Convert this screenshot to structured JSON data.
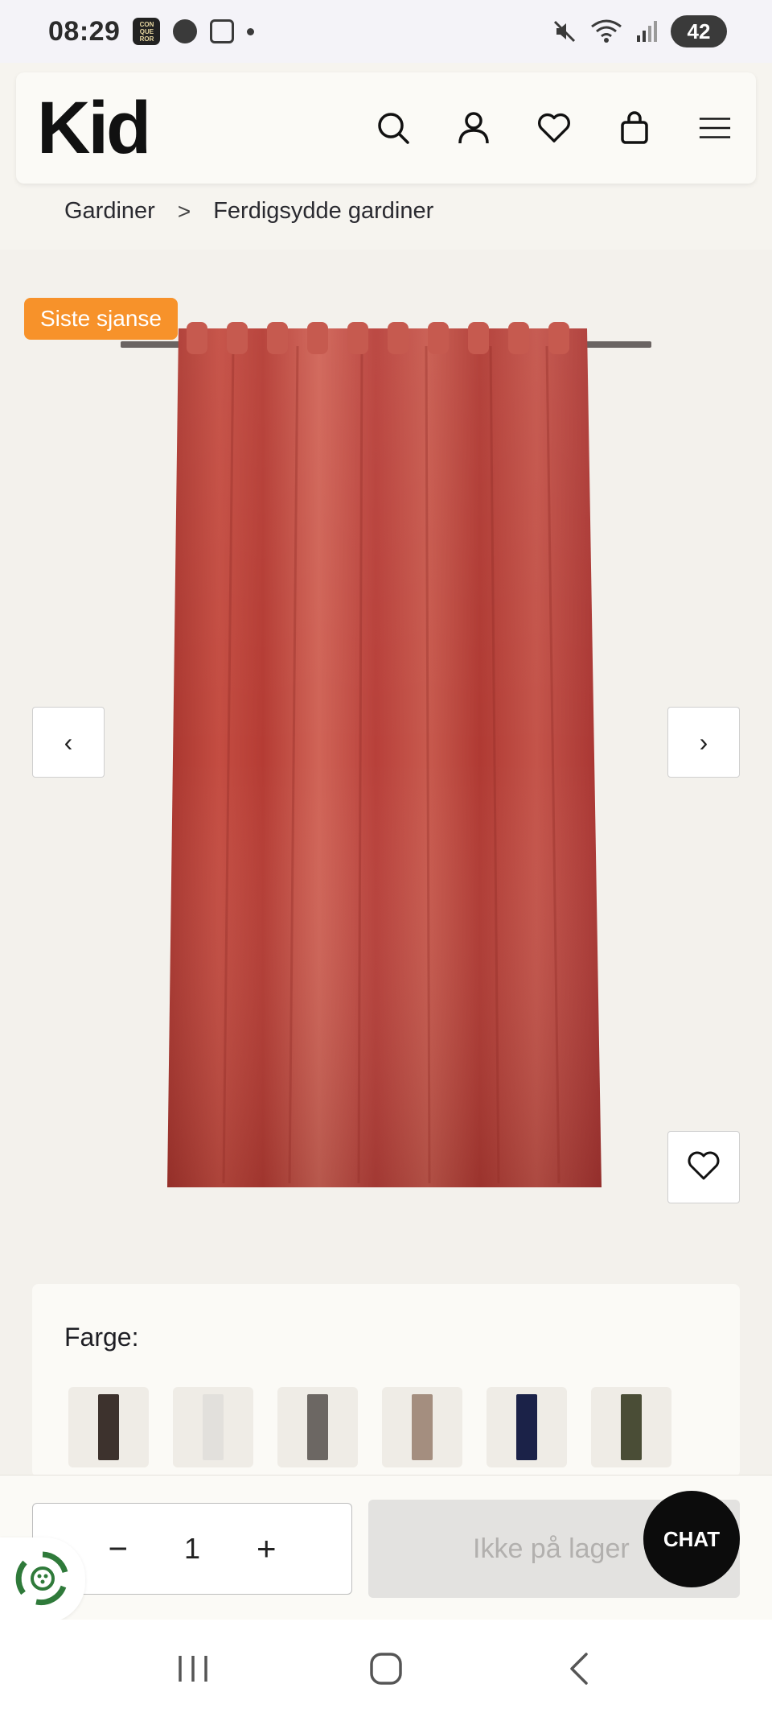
{
  "status_bar": {
    "time": "08:29",
    "battery": "42",
    "app_icon_text": "CON QUE ROR"
  },
  "header": {
    "logo": "Kid",
    "icons": [
      "search-icon",
      "account-icon",
      "wishlist-icon",
      "cart-icon",
      "menu-icon"
    ]
  },
  "breadcrumb": {
    "items": [
      "Gardiner",
      "Ferdigsydde gardiner"
    ],
    "separator": ">"
  },
  "product": {
    "badge": "Siste sjanse",
    "image_color": "#c0473c",
    "prev_label": "‹",
    "next_label": "›"
  },
  "color_selector": {
    "label": "Farge:",
    "swatches": [
      {
        "color": "#3d322d"
      },
      {
        "color": "#e2e0dc"
      },
      {
        "color": "#6c6763"
      },
      {
        "color": "#a48e7f"
      },
      {
        "color": "#1b2248"
      },
      {
        "color": "#4a4d36"
      }
    ]
  },
  "buy_bar": {
    "quantity": "1",
    "minus": "−",
    "plus": "+",
    "stock_label": "Ikke på lager"
  },
  "chat": {
    "label": "CHAT"
  },
  "colors": {
    "badge": "#f7922a",
    "background": "#f3f1ec"
  }
}
